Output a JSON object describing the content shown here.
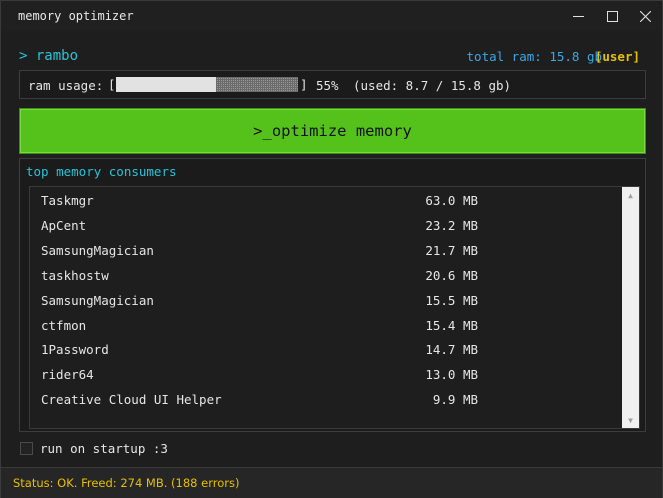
{
  "window": {
    "title": "memory optimizer"
  },
  "header": {
    "prompt_symbol": ">",
    "username": "rambo",
    "total_ram": "total ram: 15.8 gb",
    "user_tag": "[user]"
  },
  "usage": {
    "label": "ram usage:",
    "open_bracket": "[",
    "close_bracket": "]",
    "percent_text": "55%",
    "percent_value": 0.55,
    "used_text": "(used: 8.7 / 15.8 gb)"
  },
  "optimize_button": {
    "label": ">_optimize memory"
  },
  "consumers": {
    "title": "top memory consumers",
    "items": [
      {
        "name": "Taskmgr",
        "mem": "63.0 MB"
      },
      {
        "name": "ApCent",
        "mem": "23.2 MB"
      },
      {
        "name": "SamsungMagician",
        "mem": "21.7 MB"
      },
      {
        "name": "taskhostw",
        "mem": "20.6 MB"
      },
      {
        "name": "SamsungMagician",
        "mem": "15.5 MB"
      },
      {
        "name": "ctfmon",
        "mem": "15.4 MB"
      },
      {
        "name": "1Password",
        "mem": "14.7 MB"
      },
      {
        "name": "rider64",
        "mem": "13.0 MB"
      },
      {
        "name": "Creative Cloud UI Helper",
        "mem": "9.9 MB"
      }
    ]
  },
  "startup": {
    "label": "run on startup :3",
    "checked": false
  },
  "status": {
    "text": "Status: OK. Freed: 274 MB. (188 errors)"
  },
  "colors": {
    "accent_cyan": "#27c3d6",
    "accent_blue": "#3aa7e8",
    "accent_yellow": "#e5c100",
    "button_green": "#55c21b"
  }
}
